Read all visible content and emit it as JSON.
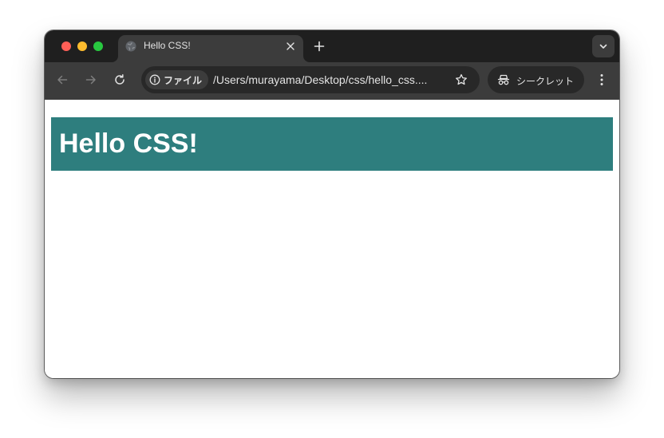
{
  "window": {
    "traffic_lights": [
      "close",
      "minimize",
      "maximize"
    ]
  },
  "tab": {
    "title": "Hello CSS!",
    "favicon": "globe-icon"
  },
  "toolbar": {
    "security_chip_label": "ファイル",
    "url": "/Users/murayama/Desktop/css/hello_css....",
    "incognito_label": "シークレット"
  },
  "page": {
    "heading": "Hello CSS!"
  },
  "colors": {
    "heading_background": "#2e7e7e",
    "heading_text": "#ffffff",
    "tabstrip": "#1f1f1f",
    "toolbar": "#3c3c3c",
    "omnibox": "#282828"
  }
}
